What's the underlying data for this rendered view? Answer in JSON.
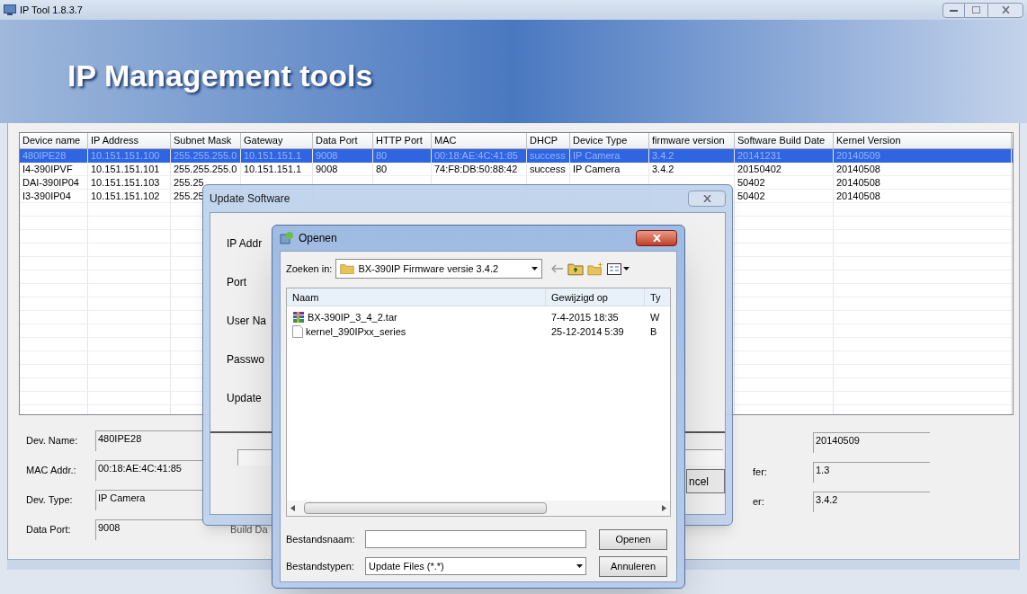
{
  "window": {
    "title": "IP Tool 1.8.3.7"
  },
  "banner": {
    "title": "IP Management tools"
  },
  "table": {
    "columns": [
      "Device name",
      "IP Address",
      "Subnet Mask",
      "Gateway",
      "Data Port",
      "HTTP Port",
      "MAC",
      "DHCP",
      "Device Type",
      "firmware version",
      "Software Build Date",
      "Kernel Version"
    ],
    "rows": [
      {
        "selected": true,
        "cells": [
          "480IPE28",
          "10.151.151.100",
          "255.255.255.0",
          "10.151.151.1",
          "9008",
          "80",
          "00:18:AE:4C:41:85",
          "success",
          "IP Camera",
          "3.4.2",
          "20141231",
          "20140509"
        ]
      },
      {
        "selected": false,
        "cells": [
          "I4-390IPVF",
          "10.151.151.101",
          "255.255.255.0",
          "10.151.151.1",
          "9008",
          "80",
          "74:F8:DB:50:88:42",
          "success",
          "IP Camera",
          "3.4.2",
          "20150402",
          "20140508"
        ]
      },
      {
        "selected": false,
        "cells": [
          "DAI-390IP04",
          "10.151.151.103",
          "255.25"
        ],
        "trailing_cells": [
          "50402",
          "20140508"
        ]
      },
      {
        "selected": false,
        "cells": [
          "I3-390IP04",
          "10.151.151.102",
          "255.25"
        ],
        "trailing_cells": [
          "50402",
          "20140508"
        ]
      }
    ]
  },
  "details": {
    "left_fields": [
      {
        "label": "Dev. Name:",
        "value": "480IPE28"
      },
      {
        "label": "MAC Addr.:",
        "value": "00:18:AE:4C:41:85"
      },
      {
        "label": "Dev. Type:",
        "value": "IP Camera"
      },
      {
        "label": "Data Port:",
        "value": "9008"
      }
    ],
    "build_label": "Build Da",
    "right_fields": [
      {
        "value": "20140509"
      },
      {
        "label": "fer:",
        "value": "1.3"
      },
      {
        "label": "er:",
        "value": "3.4.2"
      }
    ]
  },
  "update_dialog": {
    "title": "Update Software",
    "labels": [
      "IP Addr",
      "Port",
      "User Na",
      "Passwo",
      "Update"
    ],
    "cancel_button": "ncel"
  },
  "open_dialog": {
    "title": "Openen",
    "look_in_label": "Zoeken in:",
    "look_in_value": "BX-390IP Firmware versie 3.4.2",
    "columns": [
      "Naam",
      "Gewijzigd op",
      "Ty"
    ],
    "files": [
      {
        "kind": "archive",
        "name": "BX-390IP_3_4_2.tar",
        "modified": "7-4-2015 18:35",
        "type": "W"
      },
      {
        "kind": "file",
        "name": "kernel_390IPxx_series",
        "modified": "25-12-2014 5:39",
        "type": "B"
      }
    ],
    "filename_label": "Bestandsnaam:",
    "open_button": "Openen",
    "filetype_label": "Bestandstypen:",
    "filetype_value": "Update Files (*.*)",
    "cancel_button": "Annuleren"
  }
}
